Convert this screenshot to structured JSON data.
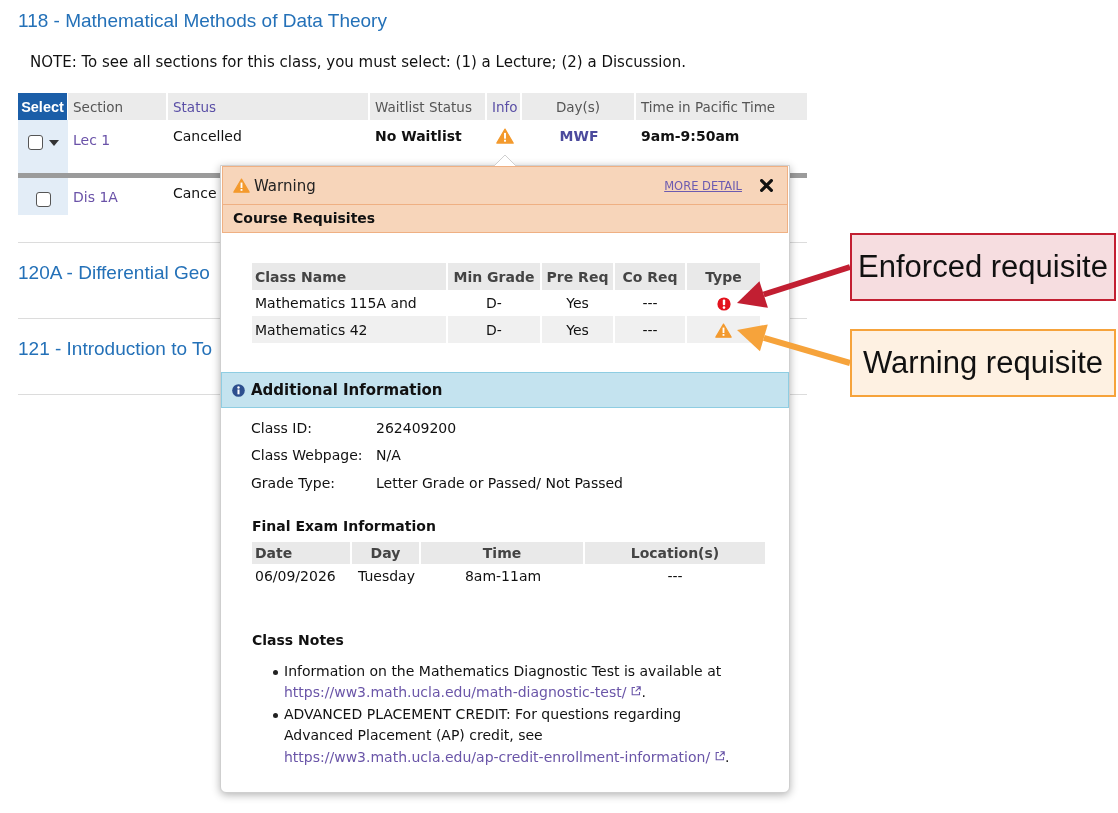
{
  "courses": [
    {
      "title": "118 - Mathematical Methods of Data Theory",
      "note": "NOTE: To see all sections for this class, you must select: (1) a Lecture; (2) a Discussion.",
      "table": {
        "columns": [
          {
            "label": "Select",
            "kind": "select"
          },
          {
            "label": "Section",
            "kind": "plain"
          },
          {
            "label": "Status",
            "kind": "link"
          },
          {
            "label": "Waitlist Status",
            "kind": "plain"
          },
          {
            "label": "Info",
            "kind": "link"
          },
          {
            "label": "Day(s)",
            "kind": "plain"
          },
          {
            "label": "Time in Pacific Time",
            "kind": "plain"
          }
        ],
        "rows": [
          {
            "kind": "lecture",
            "checked": false,
            "section": "Lec 1",
            "status": "Cancelled",
            "waitlist_status": "No Waitlist",
            "warning": true,
            "days": "MWF",
            "time": "9am-9:50am"
          },
          {
            "kind": "discussion",
            "checked": false,
            "section": "Dis 1A",
            "status": "Cance"
          }
        ]
      }
    },
    {
      "title": "120A - Differential Geo"
    },
    {
      "title": "121 - Introduction to To"
    }
  ],
  "popup": {
    "title": "Warning",
    "more_detail": "MORE DETAIL",
    "requisites": {
      "title": "Course Requisites",
      "columns": [
        "Class Name",
        "Min Grade",
        "Pre Req",
        "Co Req",
        "Type"
      ],
      "rows": [
        {
          "class_name": "Mathematics 115A and",
          "min_grade": "D-",
          "pre_req": "Yes",
          "co_req": "---",
          "kind": "enforced"
        },
        {
          "class_name": "Mathematics 42",
          "min_grade": "D-",
          "pre_req": "Yes",
          "co_req": "---",
          "kind": "warning"
        }
      ]
    },
    "additional": {
      "title": "Additional Information",
      "fields": [
        {
          "label": "Class ID:",
          "value": "262409200"
        },
        {
          "label": "Class Webpage:",
          "value": "N/A"
        },
        {
          "label": "Grade Type:",
          "value": "Letter Grade or Passed/ Not Passed"
        }
      ],
      "final_exam": {
        "title": "Final Exam Information",
        "columns": [
          "Date",
          "Day",
          "Time",
          "Location(s)"
        ],
        "rows": [
          [
            "06/09/2026",
            "Tuesday",
            "8am-11am",
            "---"
          ]
        ]
      },
      "class_notes": {
        "title": "Class Notes",
        "items": [
          {
            "text": "Information on the Mathematics Diagnostic Test is available at",
            "link": "https://ww3.math.ucla.edu/math-diagnostic-test/",
            "after": "."
          },
          {
            "text": "ADVANCED PLACEMENT CREDIT: For questions regarding Advanced Placement (AP) credit, see",
            "link": "https://ww3.math.ucla.edu/ap-credit-enrollment-information/",
            "after": "."
          }
        ]
      }
    }
  },
  "callouts": [
    {
      "text": "Enforced requisite",
      "color": "#c21f32"
    },
    {
      "text": "Warning requisite",
      "color": "#f6a33b"
    }
  ]
}
